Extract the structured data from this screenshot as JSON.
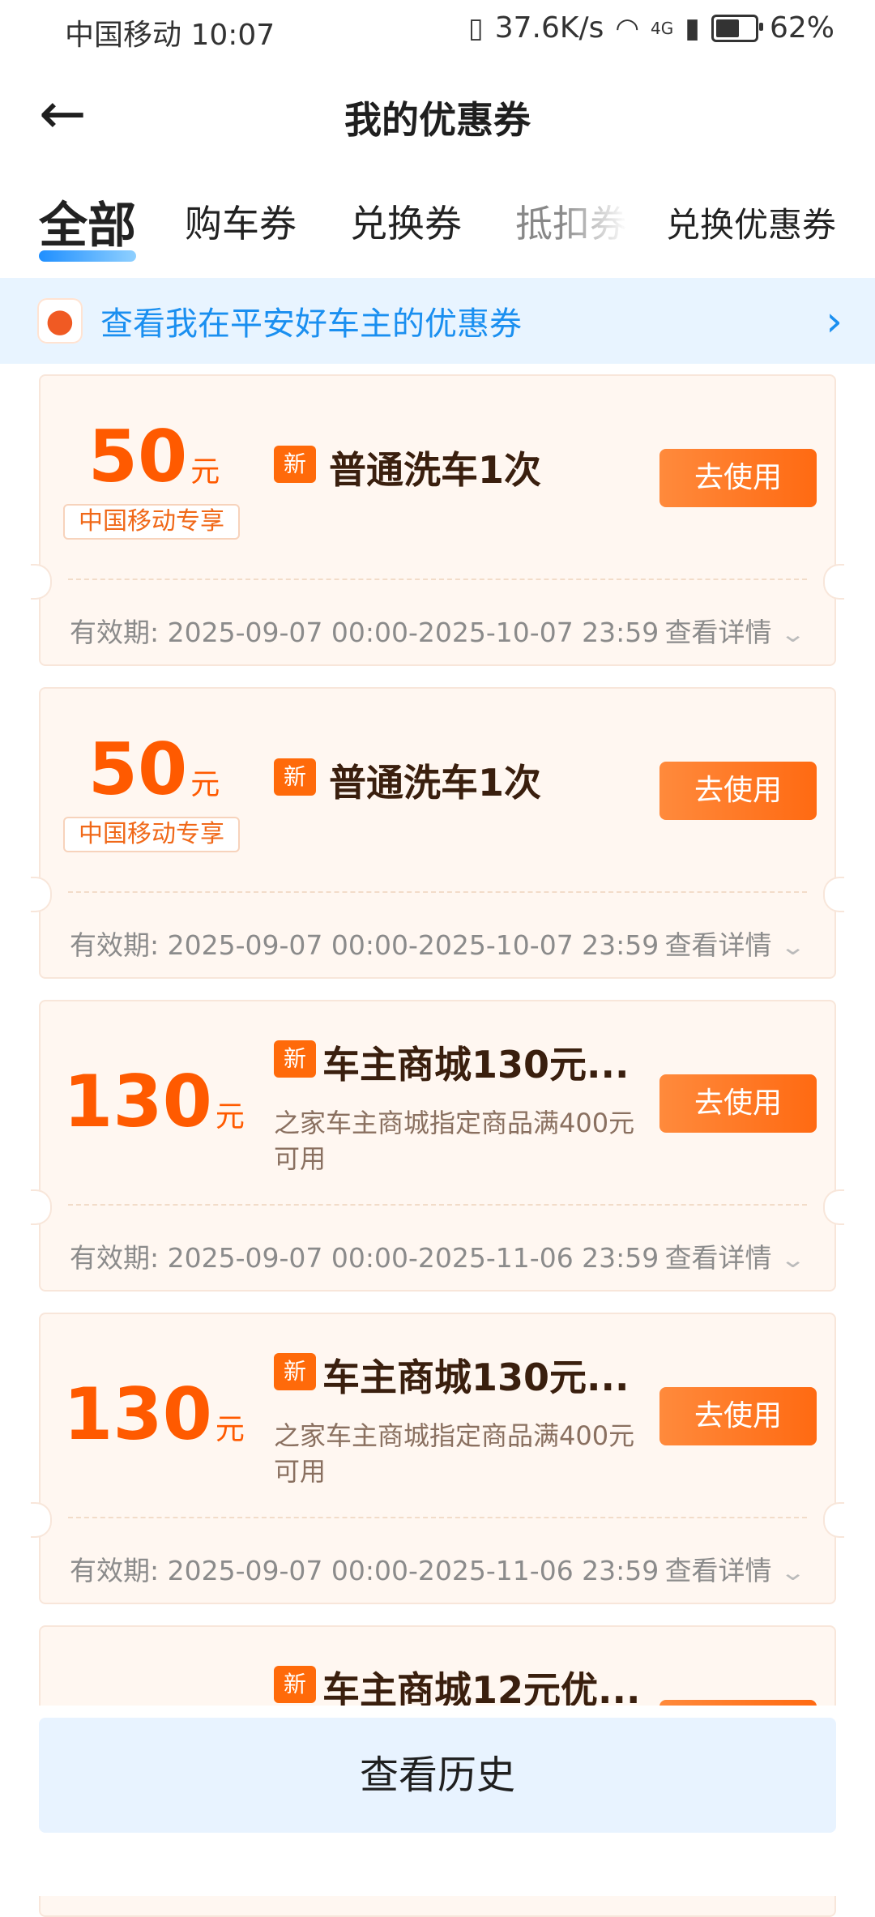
{
  "status_bar": {
    "carrier": "中国移动",
    "time": "10:07",
    "net_speed": "37.6K/s",
    "network": "4G",
    "battery": "62%"
  },
  "header": {
    "title": "我的优惠券"
  },
  "tabs": [
    {
      "label": "全部",
      "active": true
    },
    {
      "label": "购车券",
      "active": false
    },
    {
      "label": "兑换券",
      "active": false
    },
    {
      "label": "抵扣券",
      "active": false
    },
    {
      "label": "兑换优惠券",
      "active": false
    }
  ],
  "banner": {
    "text": "查看我在平安好车主的优惠券"
  },
  "coupons": [
    {
      "amount": "50",
      "unit": "元",
      "exclusive": "中国移动专享",
      "tag": "新",
      "title": "普通洗车1次",
      "button": "去使用",
      "validity_label": "有效期:",
      "validity": "2025-09-07 00:00-2025-10-07 23:59",
      "detail": "查看详情"
    },
    {
      "amount": "50",
      "unit": "元",
      "exclusive": "中国移动专享",
      "tag": "新",
      "title": "普通洗车1次",
      "button": "去使用",
      "validity_label": "有效期:",
      "validity": "2025-09-07 00:00-2025-10-07 23:59",
      "detail": "查看详情"
    },
    {
      "amount": "130",
      "unit": "元",
      "tag": "新",
      "title": "车主商城130元...",
      "desc": "之家车主商城指定商品满400元可用",
      "button": "去使用",
      "validity_label": "有效期:",
      "validity": "2025-09-07 00:00-2025-11-06 23:59",
      "detail": "查看详情"
    },
    {
      "amount": "130",
      "unit": "元",
      "tag": "新",
      "title": "车主商城130元...",
      "desc": "之家车主商城指定商品满400元可用",
      "button": "去使用",
      "validity_label": "有效期:",
      "validity": "2025-09-07 00:00-2025-11-06 23:59",
      "detail": "查看详情"
    },
    {
      "tag": "新",
      "title": "车主商城12元优..."
    }
  ],
  "footer": {
    "history_button": "查看历史"
  },
  "colors": {
    "accent": "#ff6a0a",
    "link": "#1a8ff0",
    "banner_bg": "#e8f4ff"
  }
}
